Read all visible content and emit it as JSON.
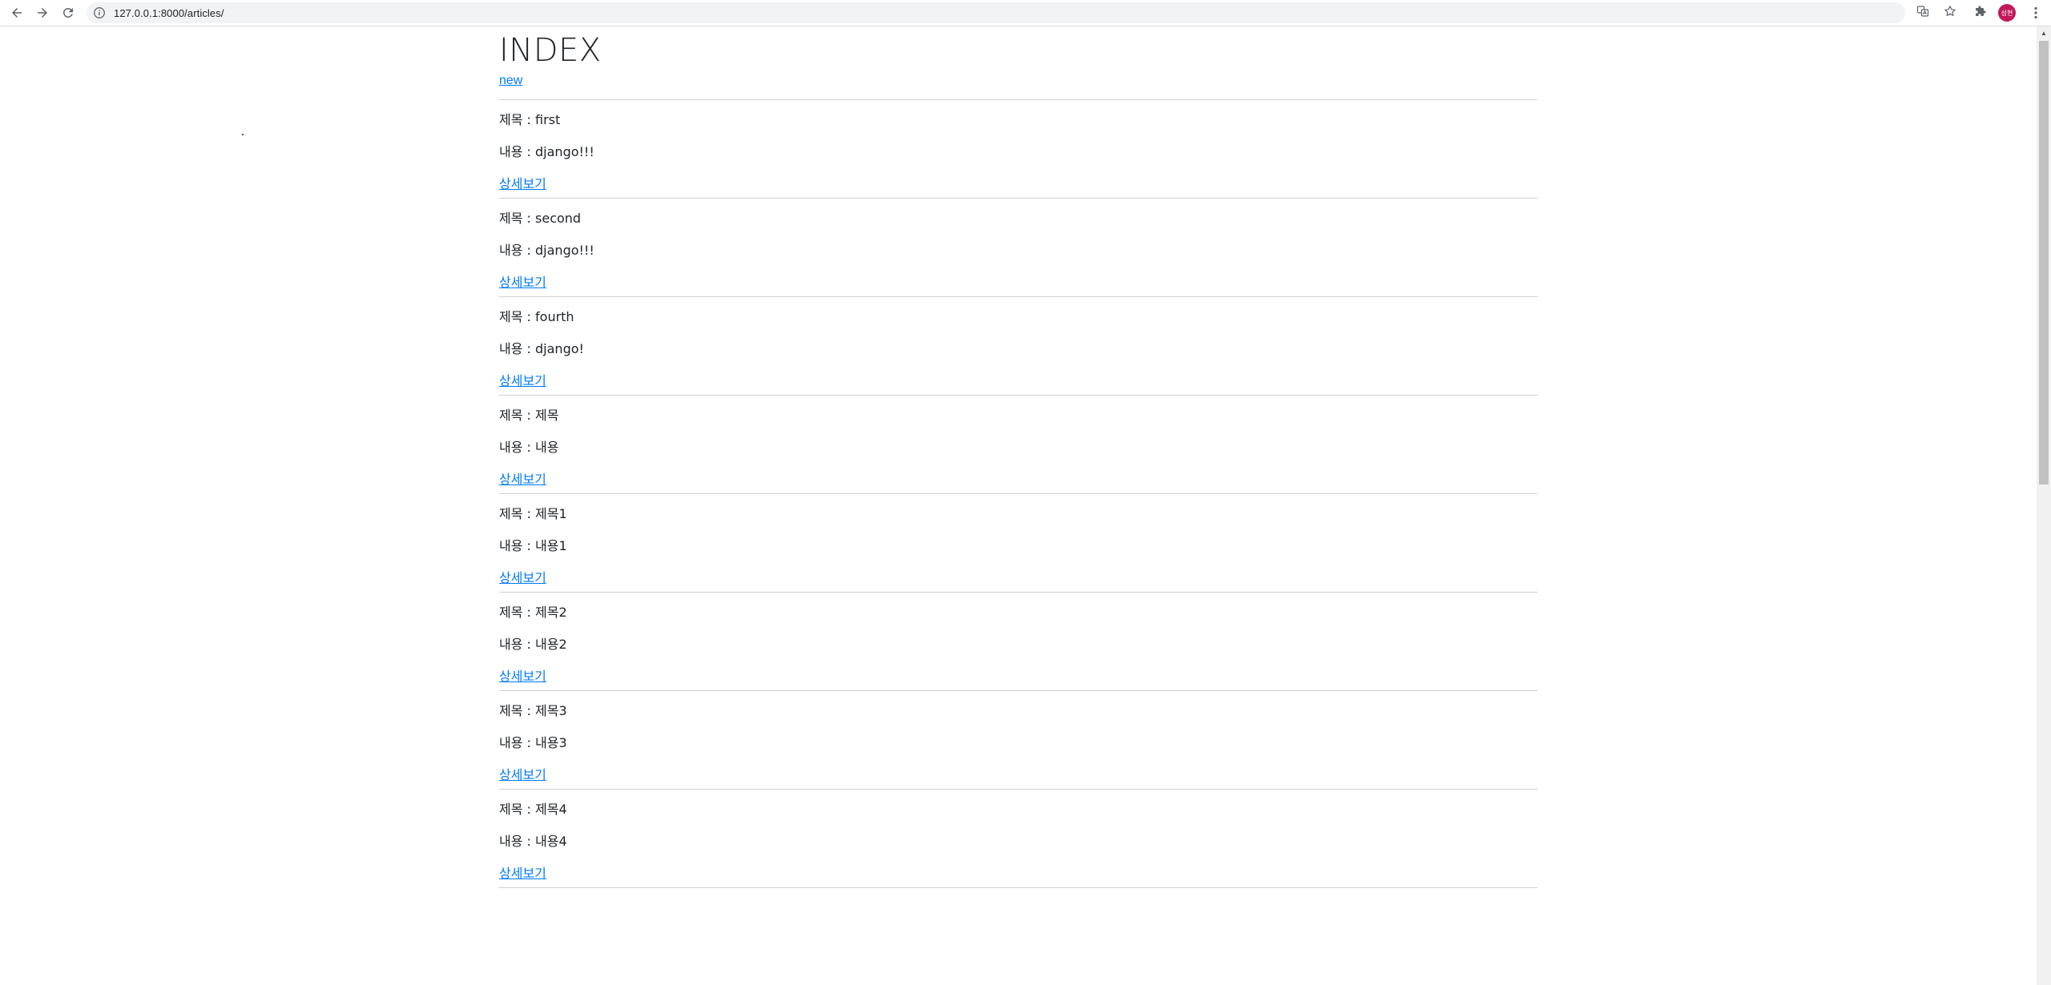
{
  "browser": {
    "url": "127.0.0.1:8000/articles/",
    "profile_initials": "성현",
    "icons": {
      "back": "arrow-left-icon",
      "forward": "arrow-right-icon",
      "reload": "reload-icon",
      "info": "info-icon",
      "translate": "translate-icon",
      "bookmark": "star-icon",
      "extensions": "puzzle-icon",
      "menu": "more-vert-icon"
    }
  },
  "page": {
    "title": "INDEX",
    "new_link": "new",
    "title_prefix": "제목 : ",
    "content_prefix": "내용 : ",
    "detail_link": "상세보기",
    "articles": [
      {
        "title": "first",
        "content": "django!!!"
      },
      {
        "title": "second",
        "content": "django!!!"
      },
      {
        "title": "fourth",
        "content": "django!"
      },
      {
        "title": "제목",
        "content": "내용"
      },
      {
        "title": "제목1",
        "content": "내용1"
      },
      {
        "title": "제목2",
        "content": "내용2"
      },
      {
        "title": "제목3",
        "content": "내용3"
      },
      {
        "title": "제목4",
        "content": "내용4"
      }
    ]
  },
  "colors": {
    "link": "#007bff",
    "text": "#212529",
    "avatar_bg": "#c2185b"
  }
}
